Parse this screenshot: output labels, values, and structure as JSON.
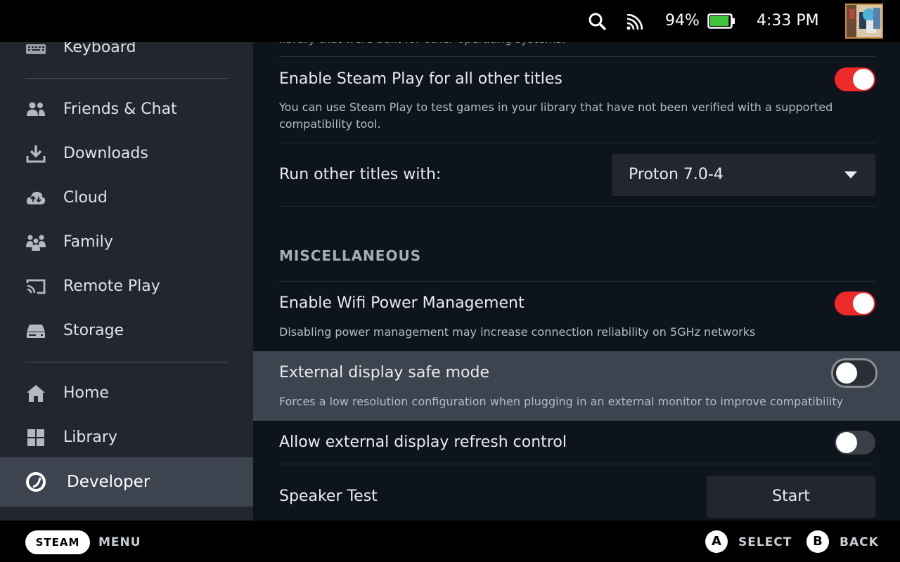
{
  "status": {
    "battery_percent": "94%",
    "battery_level": 0.94,
    "time": "4:33 PM",
    "icons": [
      "search-icon",
      "signal-icon",
      "battery-icon",
      "avatar"
    ]
  },
  "sidebar": {
    "items": [
      {
        "label": "Keyboard",
        "icon": "keyboard-icon"
      },
      {
        "label": "Friends & Chat",
        "icon": "friends-icon"
      },
      {
        "label": "Downloads",
        "icon": "download-icon"
      },
      {
        "label": "Cloud",
        "icon": "cloud-icon"
      },
      {
        "label": "Family",
        "icon": "family-icon"
      },
      {
        "label": "Remote Play",
        "icon": "cast-icon"
      },
      {
        "label": "Storage",
        "icon": "storage-icon"
      },
      {
        "label": "Home",
        "icon": "home-icon"
      },
      {
        "label": "Library",
        "icon": "library-icon"
      },
      {
        "label": "Developer",
        "icon": "developer-icon",
        "active": true
      }
    ]
  },
  "content": {
    "partial_text": "library that were built for other operating systems.",
    "steam_play_all": {
      "title": "Enable Steam Play for all other titles",
      "desc": "You can use Steam Play to test games in your library that have not been verified with a supported compatibility tool.",
      "enabled": true
    },
    "run_other": {
      "label": "Run other titles with:",
      "value": "Proton 7.0-4"
    },
    "misc_header": "MISCELLANEOUS",
    "wifi_power": {
      "title": "Enable Wifi Power Management",
      "desc": "Disabling power management may increase connection reliability on 5GHz networks",
      "enabled": true
    },
    "ext_safe_mode": {
      "title": "External display safe mode",
      "desc": "Forces a low resolution configuration when plugging in an external monitor to improve compatibility",
      "enabled": false
    },
    "ext_refresh": {
      "title": "Allow external display refresh control",
      "enabled": false
    },
    "speaker_test": {
      "title": "Speaker Test",
      "button": "Start"
    }
  },
  "bottom": {
    "steam": "STEAM",
    "menu": "MENU",
    "a_key": "A",
    "select": "SELECT",
    "b_key": "B",
    "back": "BACK"
  },
  "colors": {
    "toggle_on": "#ee2b2b",
    "sidebar_bg": "#23262e",
    "content_bg": "#0e141b",
    "battery_green": "#3cc43c"
  }
}
